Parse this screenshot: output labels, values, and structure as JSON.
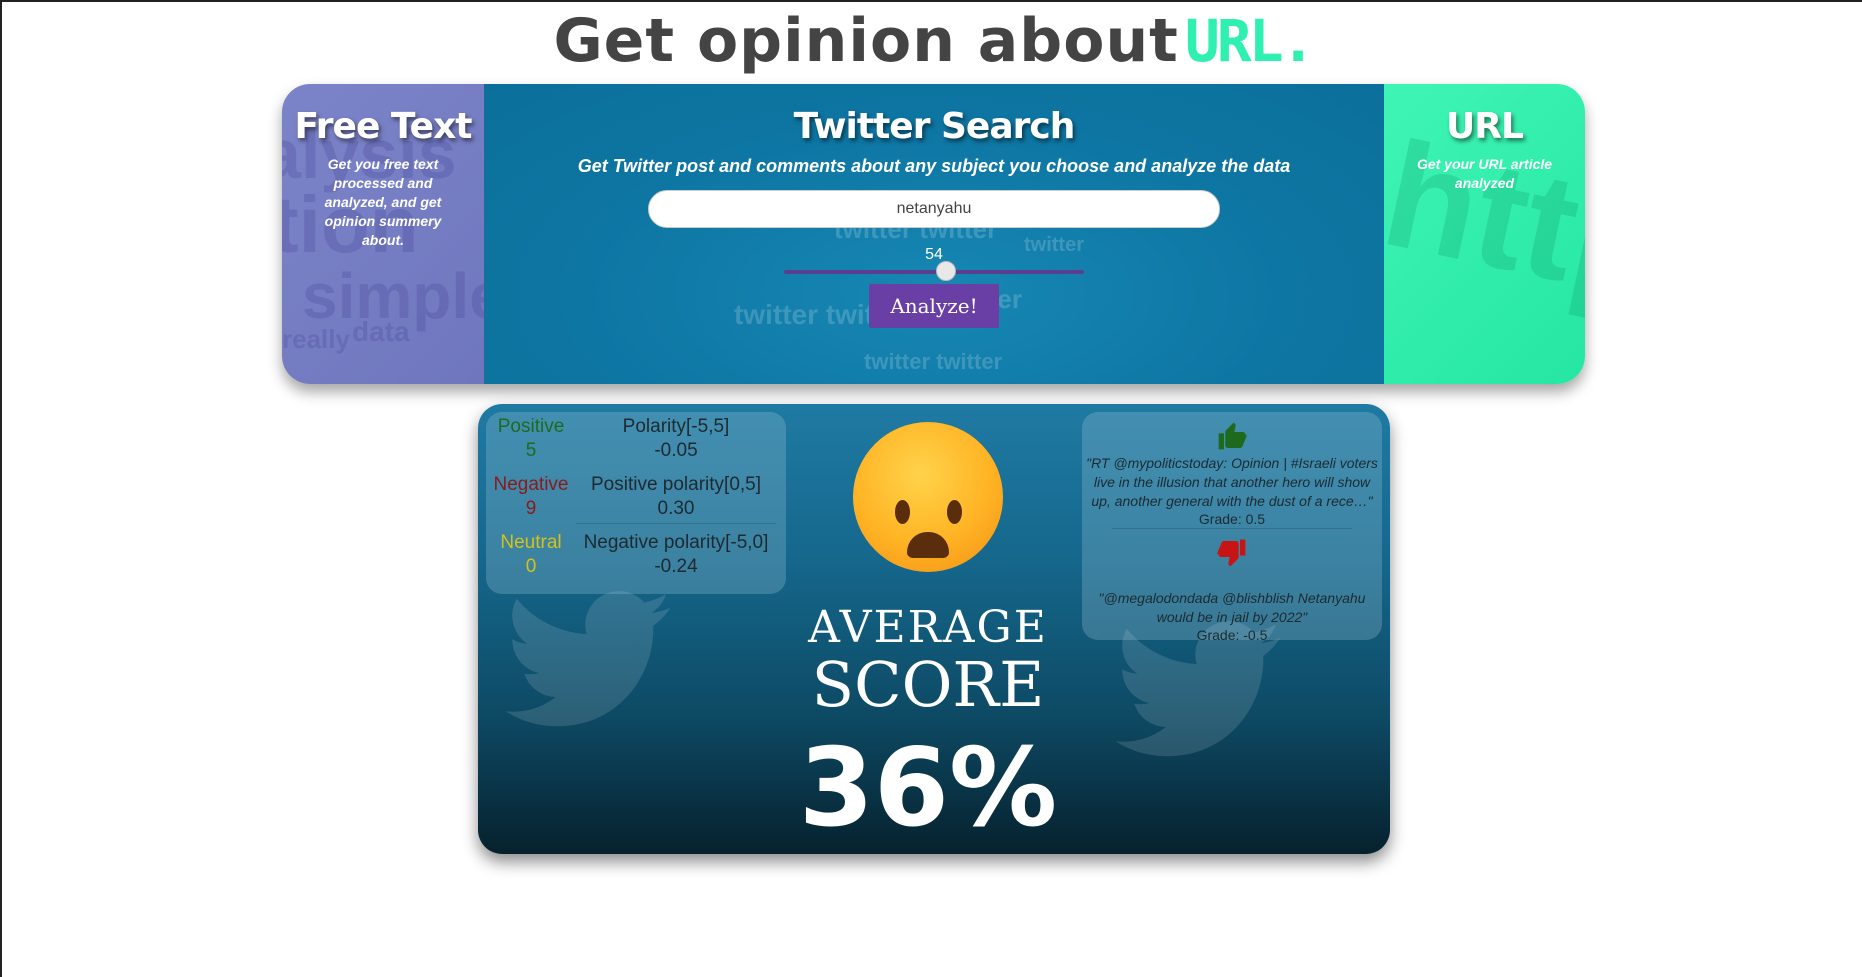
{
  "header": {
    "title_prefix": "Get opinion about",
    "title_accent": "URL."
  },
  "cards": {
    "free_text": {
      "title": "Free Text",
      "description": "Get you free text processed and analyzed, and get opinion summery about."
    },
    "twitter": {
      "title": "Twitter Search",
      "description": "Get Twitter post and comments about any subject you choose and analyze the data",
      "search_value": "netanyahu",
      "slider_value": "54",
      "slider_fraction": 0.54,
      "analyze_label": "Analyze!"
    },
    "url": {
      "title": "URL",
      "description": "Get your URL article analyzed"
    }
  },
  "stats": {
    "positive": {
      "label": "Positive",
      "count": "5",
      "color": "#1e6b1e"
    },
    "negative": {
      "label": "Negative",
      "count": "9",
      "color": "#8b1a1a"
    },
    "neutral": {
      "label": "Neutral",
      "count": "0",
      "color": "#d4c21a"
    },
    "polarity": {
      "label": "Polarity[-5,5]",
      "value": "-0.05"
    },
    "positive_polarity": {
      "label": "Positive polarity[0,5]",
      "value": "0.30"
    },
    "negative_polarity": {
      "label": "Negative polarity[-5,0]",
      "value": "-0.24"
    }
  },
  "score": {
    "line1": "AVERAGE",
    "line2": "SCORE",
    "value": "36%",
    "emoji": "frowning-face"
  },
  "comments": {
    "positive": {
      "quote": "\"RT @mypoliticstoday: Opinion | #Israeli voters live in the illusion that another hero will show up, another general with the dust of a rece…\"",
      "grade": "Grade: 0.5",
      "icon": "thumbs-up-icon",
      "color": "#1d6a1d"
    },
    "negative": {
      "quote": "\"@megalodondada @blishblish Netanyahu would be in jail by 2022\"",
      "grade": "Grade: -0.5",
      "icon": "thumbs-down-icon",
      "color": "#c81414"
    }
  }
}
